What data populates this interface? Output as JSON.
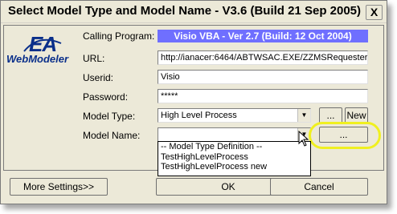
{
  "window": {
    "title": "Select Model Type and Model Name - V3.6 (Build 21 Sep 2005)",
    "close_glyph": "X"
  },
  "logo": {
    "ea_text": "EA",
    "sub_text": "WebModeler"
  },
  "form": {
    "calling_program_label": "Calling Program:",
    "calling_program_value": "Visio VBA - Ver 2.7 (Build: 12 Oct 2004)",
    "url_label": "URL:",
    "url_value": "http://ianacer:6464/ABTWSAC.EXE/ZZMSRequester",
    "userid_label": "Userid:",
    "userid_value": "Visio",
    "password_label": "Password:",
    "password_value": "*****",
    "model_type_label": "Model Type:",
    "model_type_value": "High Level Process",
    "model_name_label": "Model Name:",
    "model_name_value": "",
    "model_type_browse_label": "...",
    "new_label": "New",
    "model_name_browse_label": "..."
  },
  "dropdown": {
    "items": [
      "-- Model Type Definition --",
      "TestHighLevelProcess",
      "TestHighLevelProcess new"
    ]
  },
  "footer": {
    "more_settings_label": "More Settings>>",
    "ok_label": "OK",
    "cancel_label": "Cancel"
  },
  "colors": {
    "calling_value_bg": "#6f6fff",
    "highlight": "#f0f020",
    "logo": "#0a2f8a"
  },
  "icons": [
    "close-icon",
    "dropdown-arrow-icon",
    "mouse-cursor-icon"
  ]
}
